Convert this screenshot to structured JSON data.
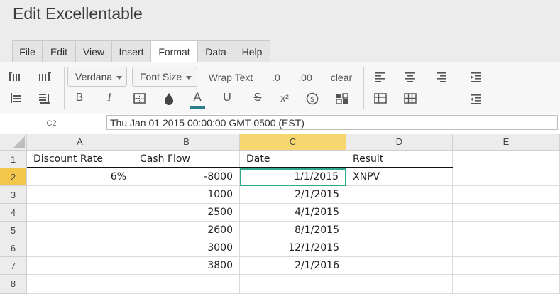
{
  "app": {
    "title": "Edit Excellentable"
  },
  "menu": {
    "tabs": [
      {
        "label": "File"
      },
      {
        "label": "Edit"
      },
      {
        "label": "View"
      },
      {
        "label": "Insert"
      },
      {
        "label": "Format",
        "active": true
      },
      {
        "label": "Data"
      },
      {
        "label": "Help"
      }
    ]
  },
  "toolbar": {
    "font_family": "Verdana",
    "font_size": "Font Size",
    "wrap_text": "Wrap Text",
    "decimals_decrease": ".0",
    "decimals_increase": ".00",
    "clear": "clear",
    "bold": "B",
    "italic": "I",
    "text_color": "A",
    "underline": "U",
    "strikethrough": "S",
    "superscript": "x²",
    "accent_color": "#2b7f8c"
  },
  "formula_bar": {
    "cell_ref": "C2",
    "value": "Thu Jan 01 2015 00:00:00 GMT-0500 (EST)"
  },
  "sheet": {
    "columns": [
      "A",
      "B",
      "C",
      "D",
      "E"
    ],
    "selected_column": "C",
    "selected_row": "2",
    "rows": [
      {
        "num": "1",
        "cells": [
          "Discount Rate",
          "Cash Flow",
          "Date",
          "Result",
          ""
        ]
      },
      {
        "num": "2",
        "cells": [
          "6%",
          "-8000",
          "1/1/2015",
          "XNPV",
          ""
        ]
      },
      {
        "num": "3",
        "cells": [
          "",
          "1000",
          "2/1/2015",
          "",
          ""
        ]
      },
      {
        "num": "4",
        "cells": [
          "",
          "2500",
          "4/1/2015",
          "",
          ""
        ]
      },
      {
        "num": "5",
        "cells": [
          "",
          "2600",
          "8/1/2015",
          "",
          ""
        ]
      },
      {
        "num": "6",
        "cells": [
          "",
          "3000",
          "12/1/2015",
          "",
          ""
        ]
      },
      {
        "num": "7",
        "cells": [
          "",
          "3800",
          "2/1/2016",
          "",
          ""
        ]
      },
      {
        "num": "8",
        "cells": [
          "",
          "",
          "",
          "",
          ""
        ]
      }
    ]
  }
}
